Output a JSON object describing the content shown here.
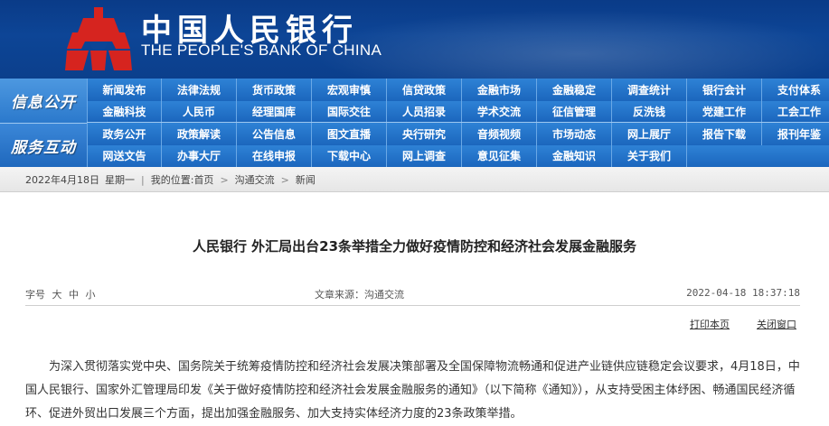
{
  "header": {
    "logo_cn": "中国人民银行",
    "logo_en": "THE PEOPLE'S BANK OF CHINA"
  },
  "nav": {
    "sections": [
      "信息公开",
      "服务互动"
    ],
    "rows": [
      [
        "新闻发布",
        "法律法规",
        "货币政策",
        "宏观审慎",
        "信贷政策",
        "金融市场",
        "金融稳定",
        "调查统计",
        "银行会计",
        "支付体系"
      ],
      [
        "金融科技",
        "人民币",
        "经理国库",
        "国际交往",
        "人员招录",
        "学术交流",
        "征信管理",
        "反洗钱",
        "党建工作",
        "工会工作"
      ],
      [
        "政务公开",
        "政策解读",
        "公告信息",
        "图文直播",
        "央行研究",
        "音频视频",
        "市场动态",
        "网上展厅",
        "报告下载",
        "报刊年鉴"
      ],
      [
        "网送文告",
        "办事大厅",
        "在线申报",
        "下载中心",
        "网上调查",
        "意见征集",
        "金融知识",
        "关于我们"
      ]
    ]
  },
  "breadcrumb": {
    "date": "2022年4月18日",
    "weekday": "星期一",
    "location_label": "我的位置:",
    "items": [
      "首页",
      "沟通交流",
      "新闻"
    ]
  },
  "article": {
    "title": "人民银行 外汇局出台23条举措全力做好疫情防控和经济社会发展金融服务",
    "font_size_label": "字号",
    "font_sizes": [
      "大",
      "中",
      "小"
    ],
    "source": "文章来源：沟通交流",
    "datetime": "2022-04-18 18:37:18",
    "print_label": "打印本页",
    "close_label": "关闭窗口",
    "body": "为深入贯彻落实党中央、国务院关于统筹疫情防控和经济社会发展决策部署及全国保障物流畅通和促进产业链供应链稳定会议要求，4月18日，中国人民银行、国家外汇管理局印发《关于做好疫情防控和经济社会发展金融服务的通知》（以下简称《通知》），从支持受困主体纾困、畅通国民经济循环、促进外贸出口发展三个方面，提出加强金融服务、加大支持实体经济力度的23条政策举措。"
  },
  "colors": {
    "header_blue": "#0d4596",
    "nav_blue": "#1f6fc4",
    "logo_red": "#d6241f"
  }
}
